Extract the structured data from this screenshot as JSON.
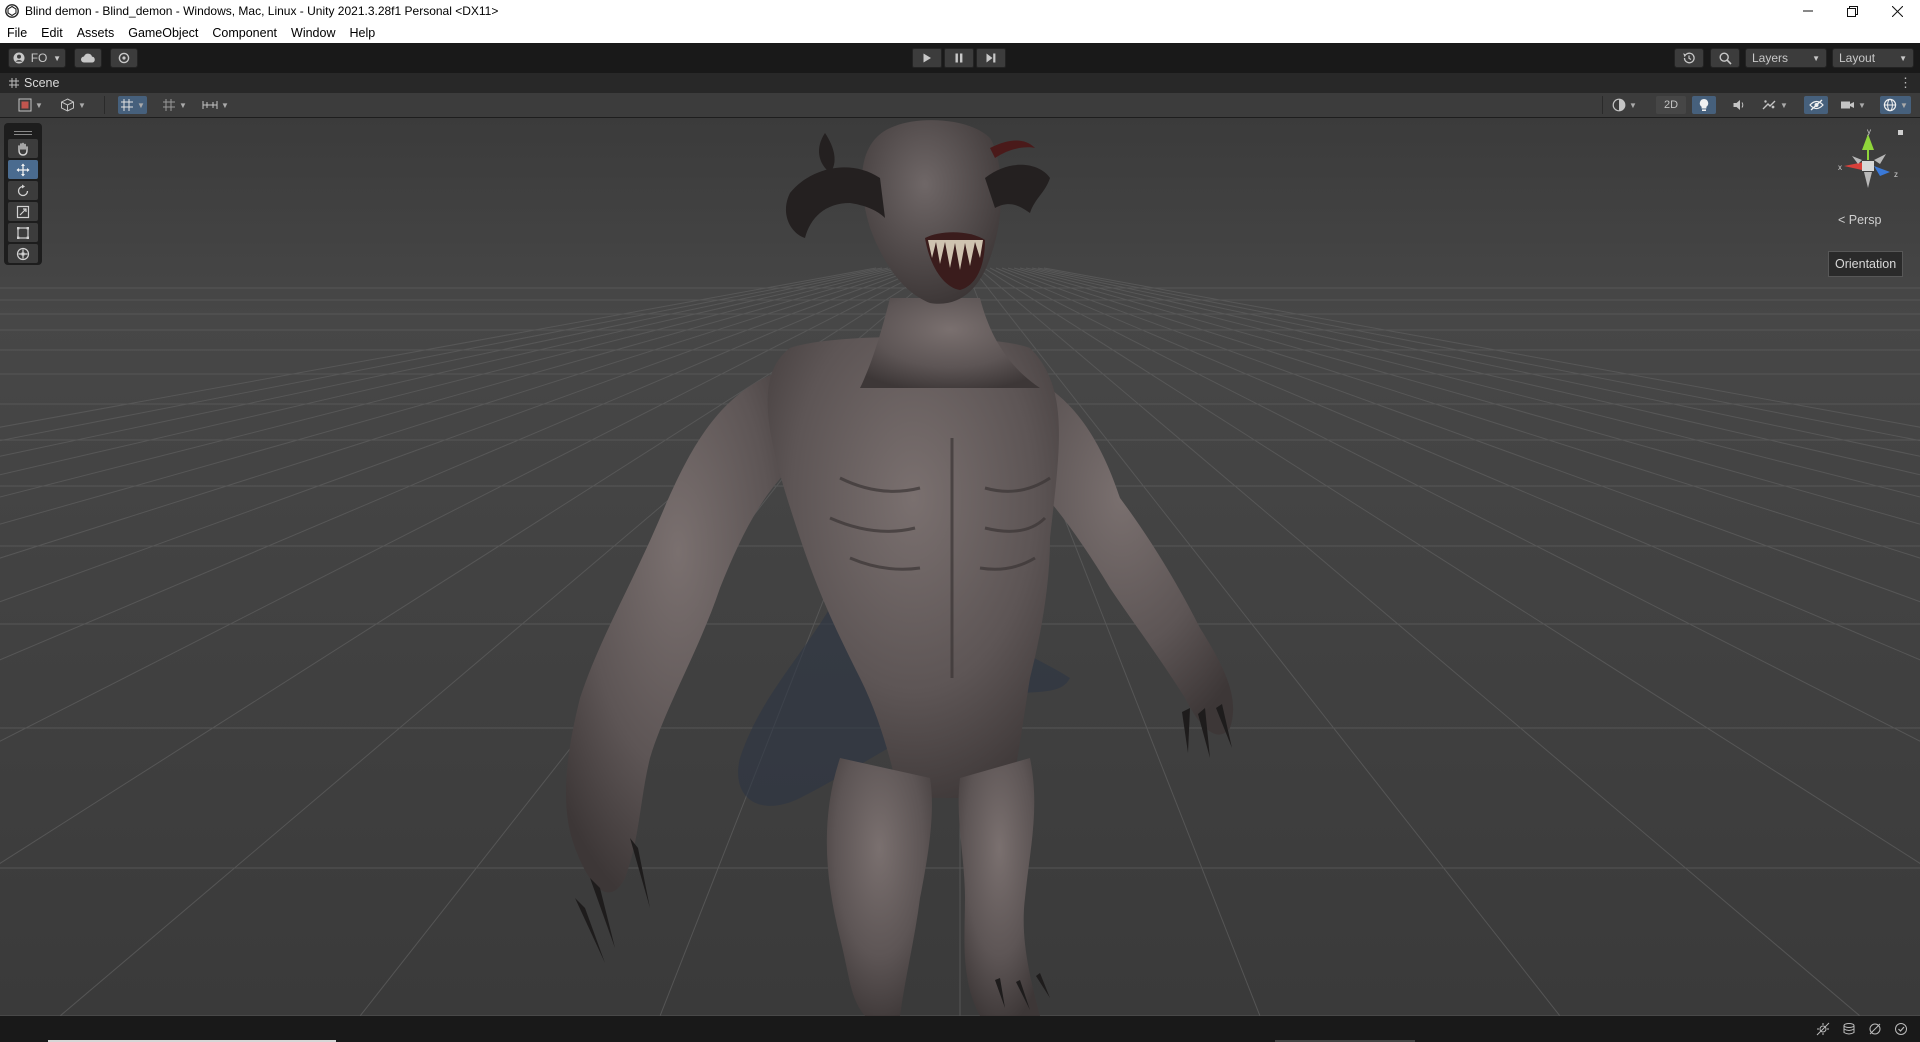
{
  "window": {
    "title": "Blind demon - Blind_demon - Windows, Mac, Linux - Unity 2021.3.28f1 Personal <DX11>",
    "app_icon": "unity-icon",
    "controls": [
      "minimize-icon",
      "restore-icon",
      "close-icon"
    ]
  },
  "menu": {
    "items": [
      "File",
      "Edit",
      "Assets",
      "GameObject",
      "Component",
      "Window",
      "Help"
    ]
  },
  "toolbar": {
    "account_label": "FO",
    "cloud_icon": "cloud-icon",
    "collab_icon": "collab-icon",
    "play_icons": [
      "play-icon",
      "pause-icon",
      "step-icon"
    ],
    "history_icon": "history-icon",
    "search_icon": "search-icon",
    "layers_label": "Layers",
    "layout_label": "Layout"
  },
  "scene_tab": {
    "label": "Scene",
    "icon": "grid-icon",
    "menu_icon": "kebab-menu-icon"
  },
  "scene_toolbar": {
    "draw_mode_icon": "shaded-icon",
    "toggle_2d_label": "2D",
    "icons_left": [
      "gizmo-shaded-icon",
      "cube-icon",
      "snap-grid-icon",
      "grid-visibility-icon",
      "increment-snap-icon"
    ],
    "icons_right": [
      "render-mode-icon",
      "lighting-icon",
      "audio-icon",
      "effects-icon",
      "visibility-icon",
      "camera-icon",
      "gizmos-icon"
    ]
  },
  "tools": [
    {
      "name": "hand-tool",
      "icon": "hand-icon",
      "active": false
    },
    {
      "name": "move-tool",
      "icon": "move-icon",
      "active": true
    },
    {
      "name": "rotate-tool",
      "icon": "rotate-icon",
      "active": false
    },
    {
      "name": "scale-tool",
      "icon": "scale-icon",
      "active": false
    },
    {
      "name": "rect-tool",
      "icon": "rect-icon",
      "active": false
    },
    {
      "name": "transform-tool",
      "icon": "transform-icon",
      "active": false
    }
  ],
  "viewport": {
    "persp_label": "< Persp",
    "orientation_tooltip": "Orientation",
    "gizmo_axes": [
      "y",
      "x",
      "z"
    ],
    "model": "demon-model"
  },
  "statusbar": {
    "icons": [
      "auto-generate-lighting-icon",
      "cache-server-icon",
      "debug-icon",
      "progress-icon"
    ]
  },
  "colors": {
    "editor_bg": "#3c3c3c",
    "toolbar_bg": "#191919",
    "viewport_bg": "#484848",
    "active_tool": "#4a6b8f",
    "axis_x": "#d8403a",
    "axis_y": "#8fd63a",
    "axis_z": "#3a79d8"
  }
}
